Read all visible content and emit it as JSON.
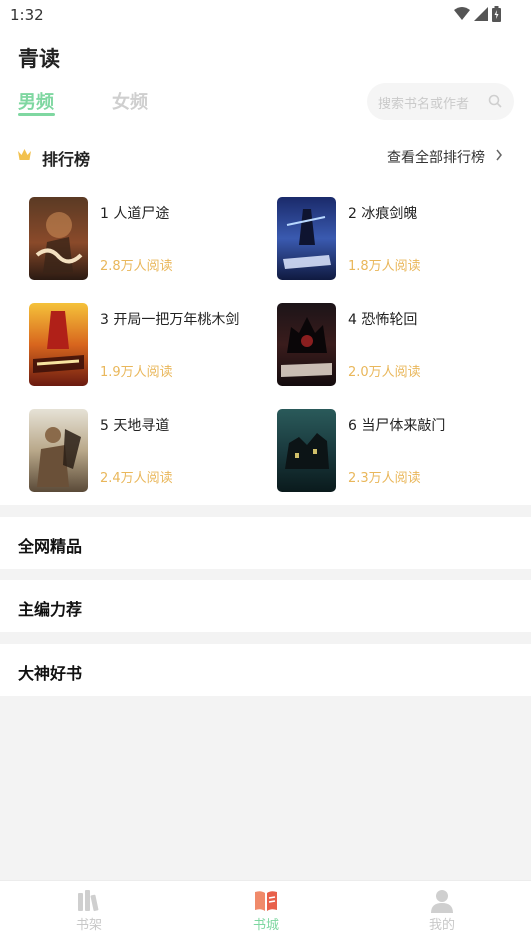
{
  "status_bar": {
    "time": "1:32"
  },
  "app": {
    "title": "青读"
  },
  "tabs": {
    "male": "男频",
    "female": "女频"
  },
  "search": {
    "placeholder": "搜索书名或作者"
  },
  "ranking": {
    "title": "排行榜",
    "view_all": "查看全部排行榜",
    "books": [
      {
        "name": "1 人道尸途",
        "readers": "2.8万人阅读"
      },
      {
        "name": "2 冰痕剑魄",
        "readers": "1.8万人阅读"
      },
      {
        "name": "3 开局一把万年桃木剑",
        "readers": "1.9万人阅读"
      },
      {
        "name": "4 恐怖轮回",
        "readers": "2.0万人阅读"
      },
      {
        "name": "5 天地寻道",
        "readers": "2.4万人阅读"
      },
      {
        "name": "6 当尸体来敲门",
        "readers": "2.3万人阅读"
      }
    ]
  },
  "sections": [
    {
      "label": "全网精品"
    },
    {
      "label": "主编力荐"
    },
    {
      "label": "大神好书"
    }
  ],
  "bottom_nav": [
    {
      "label": "书架",
      "icon": "bookshelf-icon",
      "active": false
    },
    {
      "label": "书城",
      "icon": "bookstore-icon",
      "active": true
    },
    {
      "label": "我的",
      "icon": "profile-icon",
      "active": false
    }
  ],
  "colors": {
    "accent": "#7fd7a1",
    "readers": "#e9b75b",
    "background": "#f3f3f3"
  }
}
